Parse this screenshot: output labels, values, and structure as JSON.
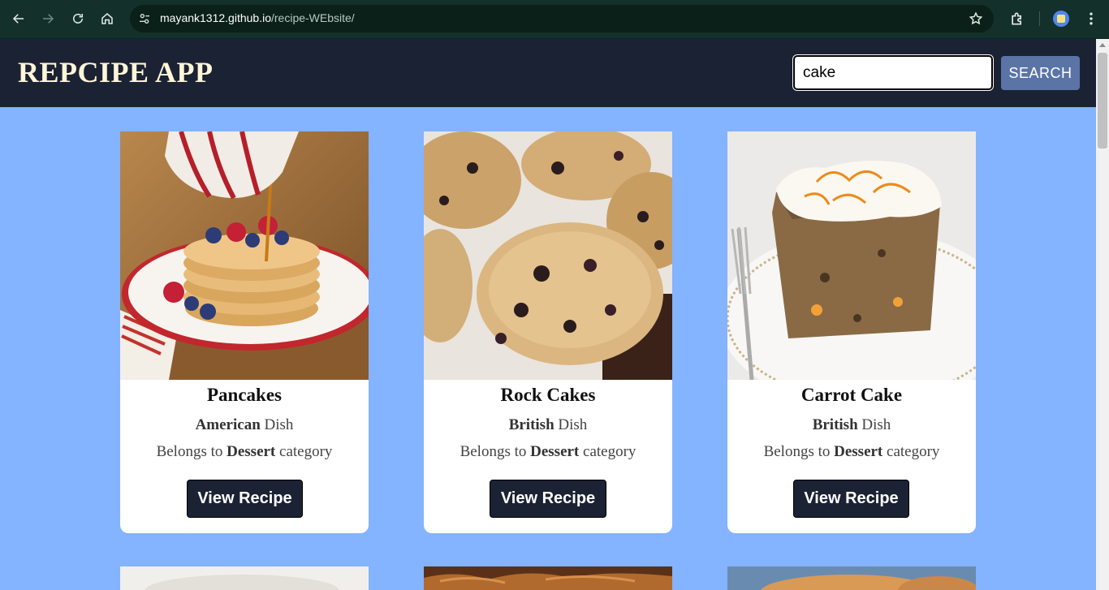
{
  "browser": {
    "url_host": "mayank1312.github.io",
    "url_path": "/recipe-WEbsite/"
  },
  "header": {
    "title": "REPCIPE APP",
    "search_value": "cake",
    "search_button": "SEARCH"
  },
  "cards": [
    {
      "title": "Pancakes",
      "area": "American",
      "area_suffix": " Dish",
      "cat_prefix": "Belongs to ",
      "category": "Dessert",
      "cat_suffix": " category",
      "button": "View Recipe"
    },
    {
      "title": "Rock Cakes",
      "area": "British",
      "area_suffix": " Dish",
      "cat_prefix": "Belongs to ",
      "category": "Dessert",
      "cat_suffix": " category",
      "button": "View Recipe"
    },
    {
      "title": "Carrot Cake",
      "area": "British",
      "area_suffix": " Dish",
      "cat_prefix": "Belongs to ",
      "category": "Dessert",
      "cat_suffix": " category",
      "button": "View Recipe"
    }
  ],
  "colors": {
    "page_bg": "#84b3ff",
    "header_bg": "#1b2233",
    "title": "#fff6d9",
    "search_button": "#5b74a6"
  }
}
